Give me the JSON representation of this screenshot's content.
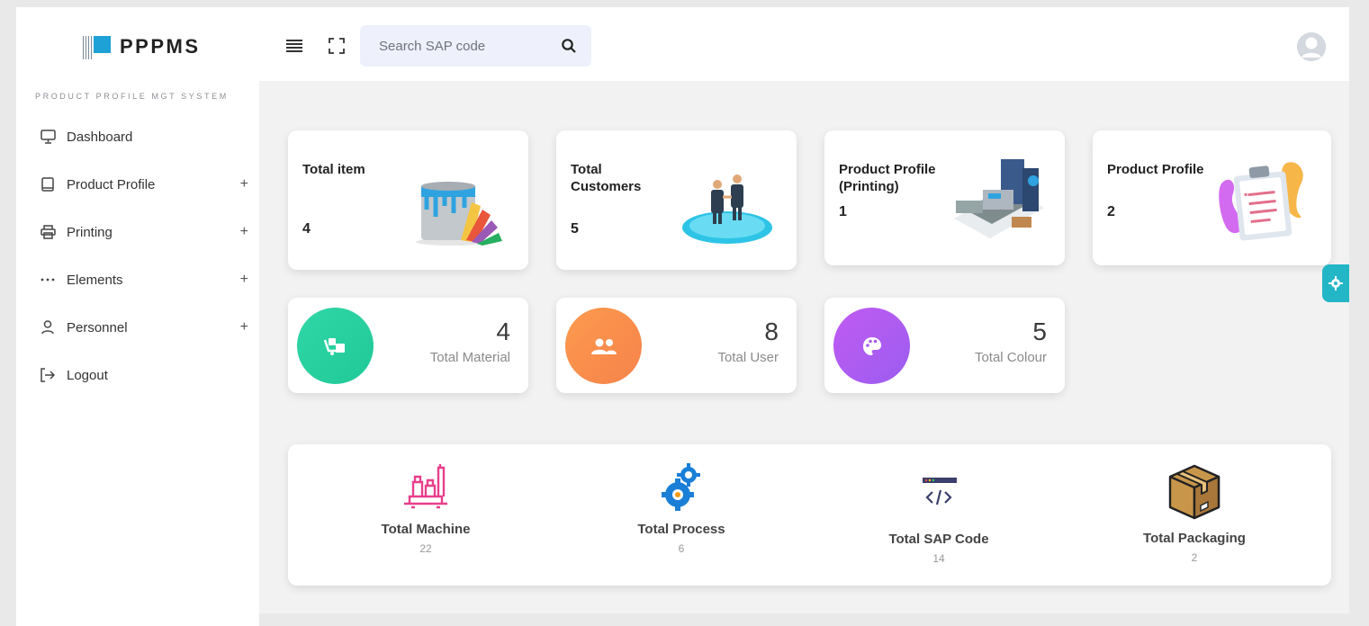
{
  "brand": {
    "name": "PPPMS",
    "caption": "PRODUCT PROFILE MGT SYSTEM",
    "accent": "#1da1d6"
  },
  "header": {
    "search_placeholder": "Search SAP code",
    "icons": [
      "menu-icon",
      "expand-icon",
      "search-icon",
      "avatar-icon"
    ]
  },
  "sidebar": {
    "items": [
      {
        "label": "Dashboard",
        "icon": "monitor-icon",
        "expandable": false
      },
      {
        "label": "Product Profile",
        "icon": "book-icon",
        "expandable": true,
        "plus": "+"
      },
      {
        "label": "Printing",
        "icon": "printer-icon",
        "expandable": true,
        "plus": "+"
      },
      {
        "label": "Elements",
        "icon": "dots-icon",
        "expandable": true,
        "plus": "+"
      },
      {
        "label": "Personnel",
        "icon": "user-icon",
        "expandable": true,
        "plus": "+"
      },
      {
        "label": "Logout",
        "icon": "logout-icon",
        "expandable": false
      }
    ]
  },
  "cards": [
    {
      "title": "Total item",
      "value": "4",
      "icon": "paint-bucket-icon"
    },
    {
      "title": "Total\nCustomers",
      "value": "5",
      "icon": "handshake-icon"
    },
    {
      "title": "Product Profile\n(Printing)",
      "value": "1",
      "icon": "printing-machine-icon"
    },
    {
      "title": "Product Profile",
      "value": "2",
      "icon": "clipboard-icon"
    }
  ],
  "stats": [
    {
      "value": "4",
      "label": "Total Material",
      "color": "#2ed3a0",
      "icon": "material-icon"
    },
    {
      "value": "8",
      "label": "Total User",
      "color": "#fb8f4b",
      "icon": "users-icon"
    },
    {
      "value": "5",
      "label": "Total Colour",
      "color": "#b35cf0",
      "icon": "palette-icon"
    }
  ],
  "bottom": [
    {
      "label": "Total Machine",
      "value": "22",
      "icon": "machine-icon"
    },
    {
      "label": "Total Process",
      "value": "6",
      "icon": "gears-icon"
    },
    {
      "label": "Total SAP Code",
      "value": "14",
      "icon": "code-icon"
    },
    {
      "label": "Total Packaging",
      "value": "2",
      "icon": "box-icon"
    }
  ],
  "settings_fab": {
    "icon": "gear-icon",
    "color": "#22b6c7"
  }
}
